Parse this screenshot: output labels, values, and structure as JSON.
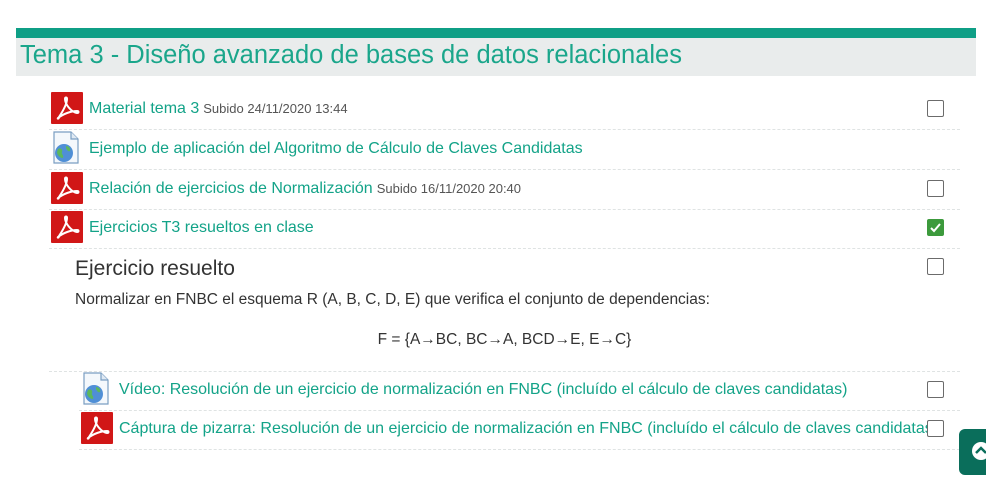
{
  "section": {
    "title": "Tema 3 - Diseño avanzado de bases de datos relacionales"
  },
  "activities": [
    {
      "icon": "pdf-icon",
      "title": "Material tema 3",
      "meta": "Subido 24/11/2020 13:44",
      "completed": false
    },
    {
      "icon": "web-icon",
      "title": "Ejemplo de aplicación del Algoritmo de Cálculo de Claves Candidatas",
      "meta": "",
      "completed": null
    },
    {
      "icon": "pdf-icon",
      "title": "Relación de ejercicios de Normalización",
      "meta": "Subido 16/11/2020 20:40",
      "completed": false
    },
    {
      "icon": "pdf-icon",
      "title": "Ejercicios T3 resueltos en clase",
      "meta": "",
      "completed": true
    }
  ],
  "label": {
    "title": "Ejercicio resuelto",
    "text": "Normalizar en FNBC el esquema R (A, B, C, D, E) que verifica el conjunto de dependencias:",
    "formula": "F = {A→BC, BC→A, BCD→E, E→C}",
    "completed": false
  },
  "sub_activities": [
    {
      "icon": "web-icon",
      "title": "Vídeo: Resolución de un ejercicio de normalización en FNBC (incluído el cálculo de claves candidatas)",
      "completed": false
    },
    {
      "icon": "pdf-icon",
      "title": "Cáptura de pizarra: Resolución de un ejercicio de normalización en FNBC (incluído el cálculo de claves candidatas)",
      "completed": false
    }
  ],
  "colors": {
    "accent": "#0f9f86",
    "link": "#13a388",
    "pdf": "#d11717",
    "check": "#3c9a3c",
    "scroll_button": "#0a6e5b"
  },
  "scroll_top": {
    "icon": "chevron-up-icon"
  }
}
